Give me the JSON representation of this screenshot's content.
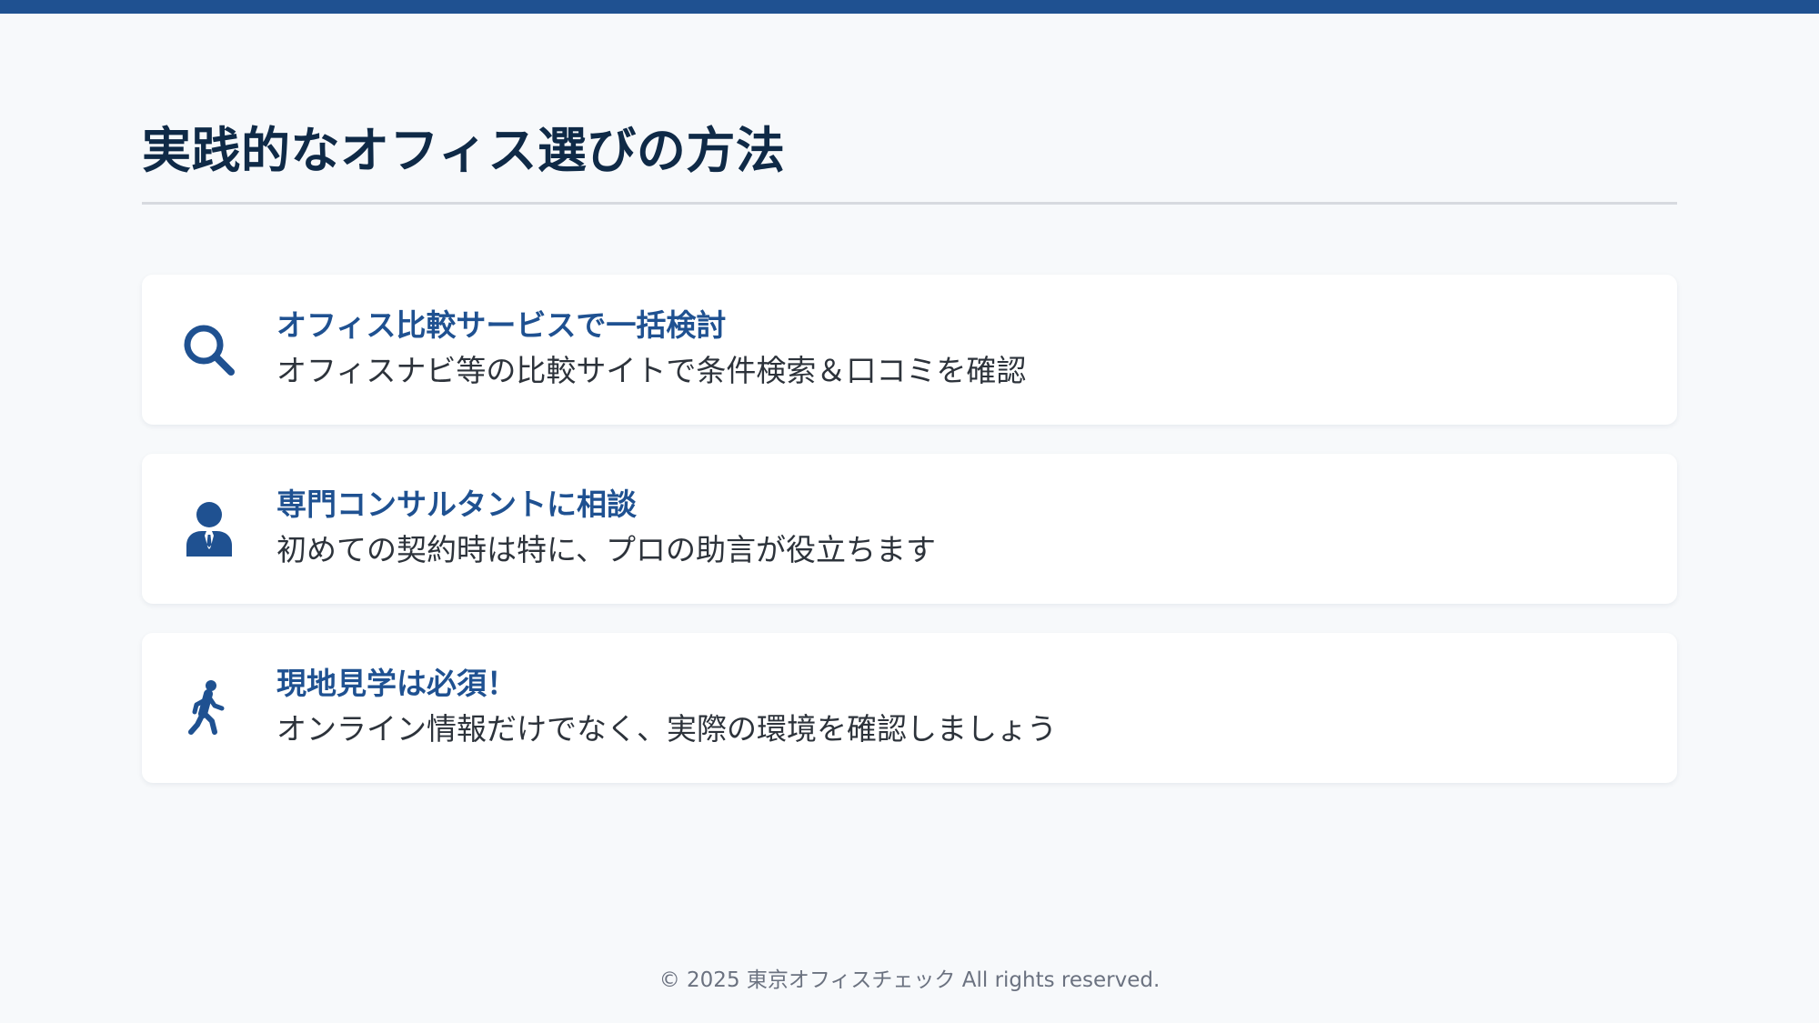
{
  "page": {
    "title": "実践的なオフィス選びの方法",
    "accent_color": "#1f5191",
    "title_color": "#0f2a47",
    "background_color": "#f7f9fb"
  },
  "cards": [
    {
      "icon": "search-icon",
      "heading": "オフィス比較サービスで一括検討",
      "description": "オフィスナビ等の比較サイトで条件検索＆口コミを確認"
    },
    {
      "icon": "consultant-icon",
      "heading": "専門コンサルタントに相談",
      "description": "初めての契約時は特に、プロの助言が役立ちます"
    },
    {
      "icon": "walking-person-icon",
      "heading": "現地見学は必須！",
      "description": "オンライン情報だけでなく、実際の環境を確認しましょう"
    }
  ],
  "footer": {
    "copyright": "© 2025 東京オフィスチェック All rights reserved."
  }
}
